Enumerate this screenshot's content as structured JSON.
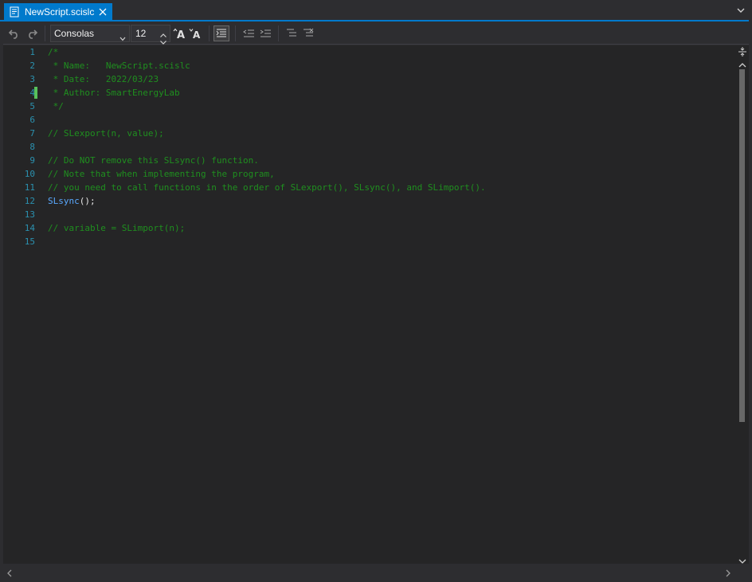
{
  "tab": {
    "title": "NewScript.scislc",
    "icon": "script-file-icon",
    "active_color": "#007acc"
  },
  "toolbar": {
    "font_family": "Consolas",
    "font_size": "12"
  },
  "editor": {
    "lines": [
      {
        "num": "1",
        "text": "/*",
        "kind": "comment"
      },
      {
        "num": "2",
        "text": " * Name:   NewScript.scislc",
        "kind": "comment"
      },
      {
        "num": "3",
        "text": " * Date:   2022/03/23",
        "kind": "comment"
      },
      {
        "num": "4",
        "text": " * Author: SmartEnergyLab",
        "kind": "comment"
      },
      {
        "num": "5",
        "text": " */",
        "kind": "comment"
      },
      {
        "num": "6",
        "text": "",
        "kind": "plain"
      },
      {
        "num": "7",
        "text": "// SLexport(n, value);",
        "kind": "comment"
      },
      {
        "num": "8",
        "text": "",
        "kind": "plain"
      },
      {
        "num": "9",
        "text": "// Do NOT remove this SLsync() function.",
        "kind": "comment"
      },
      {
        "num": "10",
        "text": "// Note that when implementing the program,",
        "kind": "comment"
      },
      {
        "num": "11",
        "text": "// you need to call functions in the order of SLexport(), SLsync(), and SLimport().",
        "kind": "comment"
      },
      {
        "num": "12",
        "text": "SLsync();",
        "kind": "code"
      },
      {
        "num": "13",
        "text": "",
        "kind": "plain"
      },
      {
        "num": "14",
        "text": "// variable = SLimport(n);",
        "kind": "comment"
      },
      {
        "num": "15",
        "text": "",
        "kind": "plain"
      }
    ],
    "code_line_12": {
      "fn_name": "SLsync",
      "rest": "();"
    },
    "changed_line": "4",
    "colors": {
      "comment": "#1f8f1f",
      "line_number": "#2b91af",
      "function": "#5aa9ff",
      "change_marker": "#57c15b",
      "background": "#252526"
    }
  }
}
